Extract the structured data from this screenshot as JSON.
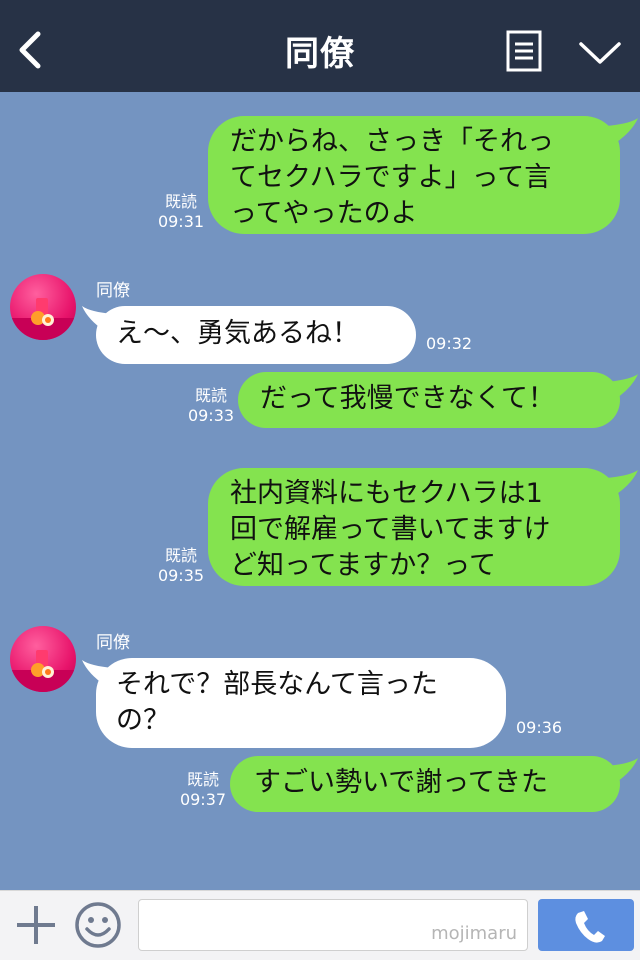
{
  "header": {
    "title": "同僚"
  },
  "messages": [
    {
      "dir": "out",
      "lines": [
        "だからね、さっき「それっ",
        "てセクハラですよ」って言",
        "ってやったのよ"
      ],
      "read": "既読",
      "time": "09:31"
    },
    {
      "dir": "in",
      "sender": "同僚",
      "lines": [
        "え〜、勇気あるね！"
      ],
      "time": "09:32"
    },
    {
      "dir": "out",
      "lines": [
        "だって我慢できなくて！"
      ],
      "read": "既読",
      "time": "09:33"
    },
    {
      "dir": "out",
      "lines": [
        "社内資料にもセクハラは1",
        "回で解雇って書いてますけ",
        "ど知ってますか？って"
      ],
      "read": "既読",
      "time": "09:35"
    },
    {
      "dir": "in",
      "sender": "同僚",
      "lines": [
        "それで？部長なんて言った",
        "の？"
      ],
      "time": "09:36"
    },
    {
      "dir": "out",
      "lines": [
        "すごい勢いで謝ってきた"
      ],
      "read": "既読",
      "time": "09:37"
    }
  ],
  "footer": {
    "watermark": "mojimaru"
  },
  "colors": {
    "header": "#273246",
    "background": "#7494c1",
    "outgoing": "#84e34f",
    "incoming": "#ffffff",
    "call": "#5d8fe0"
  }
}
